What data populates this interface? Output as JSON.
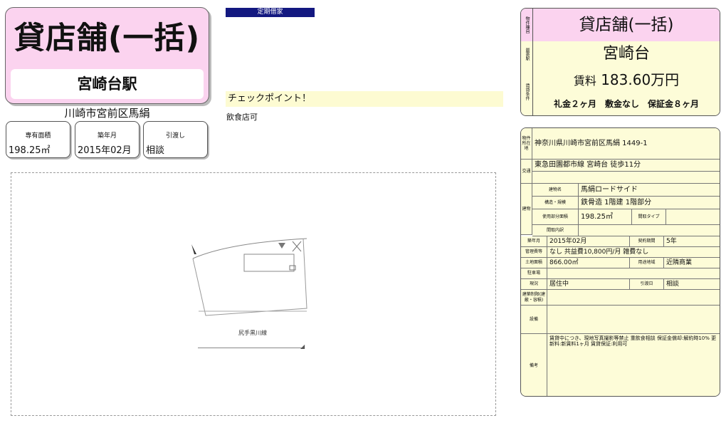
{
  "title": {
    "main": "貸店舗(一括)",
    "station": "宮崎台駅",
    "address": "川崎市宮前区馬絹"
  },
  "mini": [
    {
      "label": "専有面積",
      "value": "198.25㎡"
    },
    {
      "label": "築年月",
      "value": "2015年02月"
    },
    {
      "label": "引渡し",
      "value": "相談"
    }
  ],
  "teiki": "定期借家",
  "check": {
    "heading": "チェックポイント！",
    "text": "飲食店可"
  },
  "map": {
    "label": "尻手黒川線"
  },
  "summary": {
    "h1": "物件種目",
    "type": "貸店舗(一括)",
    "h2": "最寄駅",
    "station": "宮崎台",
    "h3": "賃貸条件",
    "rent_label": "賃料",
    "rent_value": "183.60万円",
    "terms": "礼金２ヶ月　敷金なし　保証金８ヶ月"
  },
  "detail": {
    "h_location": "物件所在地",
    "location": "神奈川県川崎市宮前区馬絹 1449-1",
    "h_transport": "交通",
    "transport": "東急田園都市線 宮崎台 徒歩11分",
    "h_building": "建物",
    "h_bname": "建物名",
    "bname": "馬絹ロードサイド",
    "h_struct": "構造・規模",
    "struct": "鉄骨造 1階建 1階部分",
    "h_area": "使用部分面積",
    "area": "198.25㎡",
    "h_layout": "間取タイプ",
    "h_inner": "間取内訳",
    "h_built": "築年月",
    "built": "2015年02月",
    "h_period": "契約期間",
    "period": "5年",
    "h_mgmt": "管理費等",
    "mgmt": "なし 共益費10,800円/月 雑費なし",
    "h_land": "土地面積",
    "land": "866.00㎡",
    "h_zone": "用途地域",
    "zone": "近隣商業",
    "h_parking": "駐車場",
    "h_status": "現況",
    "status": "居住中",
    "h_handover": "引渡日",
    "handover": "相談",
    "h_limit": "建築制限(建蔽・容積)",
    "h_equip": "設備",
    "h_notes": "備考",
    "notes": "賃貸中につき、現地写真撮影等禁止 重飲食相談 保証金償却:解約時10% 更新料:新賃料1ヶ月 賃貸保証:利用可"
  }
}
